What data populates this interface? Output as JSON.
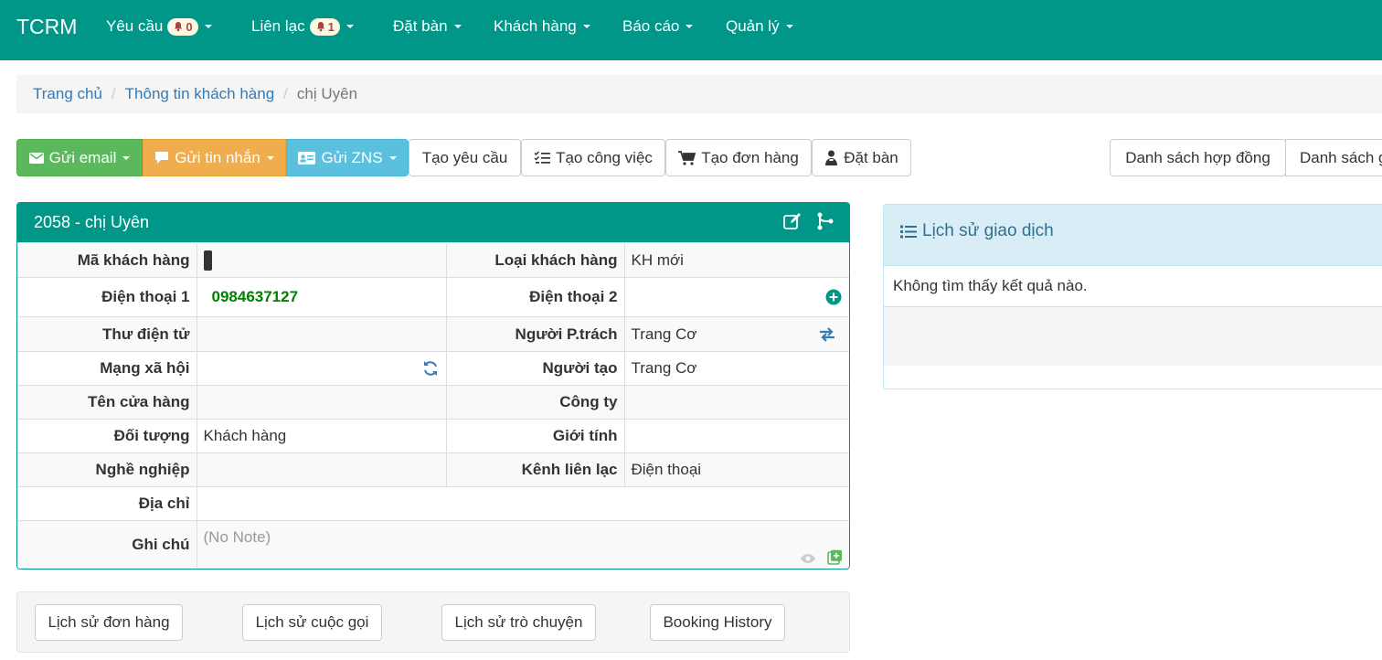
{
  "navbar": {
    "brand": "TCRM",
    "items": [
      {
        "label": "Yêu cầu",
        "badge": "0"
      },
      {
        "label": "Liên lạc",
        "badge": "1"
      },
      {
        "label": "Đặt bàn"
      },
      {
        "label": "Khách hàng"
      },
      {
        "label": "Báo cáo"
      },
      {
        "label": "Quản lý"
      }
    ]
  },
  "breadcrumb": [
    "Trang chủ",
    "Thông tin khách hàng",
    "chị Uyên"
  ],
  "toolbar": {
    "send_email": "Gửi email",
    "send_message": "Gửi tin nhắn",
    "send_zns": "Gửi ZNS",
    "create_request": "Tạo yêu cầu",
    "create_task": "Tạo công việc",
    "create_order": "Tạo đơn hàng",
    "book_table": "Đặt bàn",
    "contract_list": "Danh sách hợp đồng",
    "other_list": "Danh sách g"
  },
  "customer": {
    "title": "2058 - chị Uyên",
    "rows": [
      {
        "l1": "Mã khách hàng",
        "v1": "",
        "l2": "Loại khách hàng",
        "v2": "KH mới"
      },
      {
        "l1": "Điện thoại 1",
        "v1": "0984637127",
        "l2": "Điện thoại 2",
        "v2": ""
      },
      {
        "l1": "Thư điện tử",
        "v1": "",
        "l2": "Người P.trách",
        "v2": "Trang Cơ"
      },
      {
        "l1": "Mạng xã hội",
        "v1": "",
        "l2": "Người tạo",
        "v2": "Trang Cơ"
      },
      {
        "l1": "Tên cửa hàng",
        "v1": "",
        "l2": "Công ty",
        "v2": ""
      },
      {
        "l1": "Đối tượng",
        "v1": "Khách hàng",
        "l2": "Giới tính",
        "v2": ""
      },
      {
        "l1": "Nghề nghiệp",
        "v1": "",
        "l2": "Kênh liên lạc",
        "v2": "Điện thoại"
      }
    ],
    "address_label": "Địa chỉ",
    "address_value": "",
    "note_label": "Ghi chú",
    "note_value": "(No Note)"
  },
  "transactions": {
    "title": "Lịch sử giao dịch",
    "empty": "Không tìm thấy kết quả nào."
  },
  "history_buttons": {
    "orders": "Lịch sử đơn hàng",
    "calls": "Lịch sử cuộc gọi",
    "chats": "Lịch sử trò chuyện",
    "booking": "Booking History"
  },
  "colors": {
    "primary": "#009688",
    "success": "#5cb85c",
    "warning": "#f0ad4e",
    "info": "#5bc0de",
    "link": "#337ab7",
    "phone": "#008000"
  }
}
